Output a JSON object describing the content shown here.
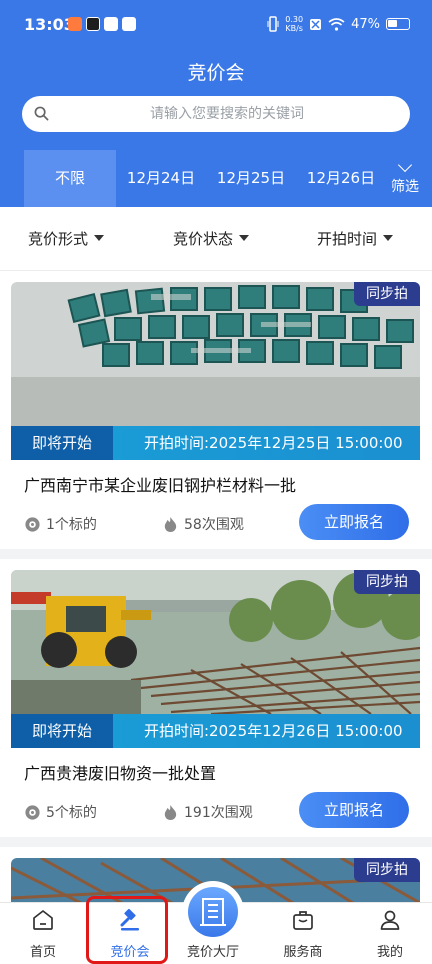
{
  "status_bar": {
    "time": "13:03",
    "net_speed_value": "0.30",
    "net_speed_unit": "KB/s",
    "battery": "47%"
  },
  "header": {
    "title": "竞价会"
  },
  "search": {
    "placeholder": "请输入您要搜索的关键词"
  },
  "date_tabs": [
    {
      "label": "不限",
      "active": true
    },
    {
      "label": "12月24日"
    },
    {
      "label": "12月25日"
    },
    {
      "label": "12月26日"
    }
  ],
  "filter": {
    "label": "筛选"
  },
  "sort_bar": [
    {
      "label": "竞价形式"
    },
    {
      "label": "竞价状态"
    },
    {
      "label": "开拍时间"
    }
  ],
  "cards": [
    {
      "badge": "同步拍",
      "status": "即将开始",
      "start_time": "开拍时间:2025年12月25日 15:00:00",
      "title": "广西南宁市某企业废旧钢护栏材料一批",
      "lots": "1个标的",
      "views": "58次围观",
      "button": "立即报名"
    },
    {
      "badge": "同步拍",
      "status": "即将开始",
      "start_time": "开拍时间:2025年12月26日 15:00:00",
      "title": "广西贵港废旧物资一批处置",
      "lots": "5个标的",
      "views": "191次围观",
      "button": "立即报名"
    },
    {
      "badge": "同步拍"
    }
  ],
  "tab_bar": [
    {
      "label": "首页",
      "icon": "home-icon"
    },
    {
      "label": "竞价会",
      "icon": "auction-hammer-icon",
      "active": true
    },
    {
      "label": "竞价大厅",
      "icon": "building-icon"
    },
    {
      "label": "服务商",
      "icon": "briefcase-icon"
    },
    {
      "label": "我的",
      "icon": "user-icon"
    }
  ],
  "colors": {
    "brand_blue": "#3b78e7",
    "badge_navy": "#2c3c8f",
    "highlight_red": "#e01818"
  }
}
